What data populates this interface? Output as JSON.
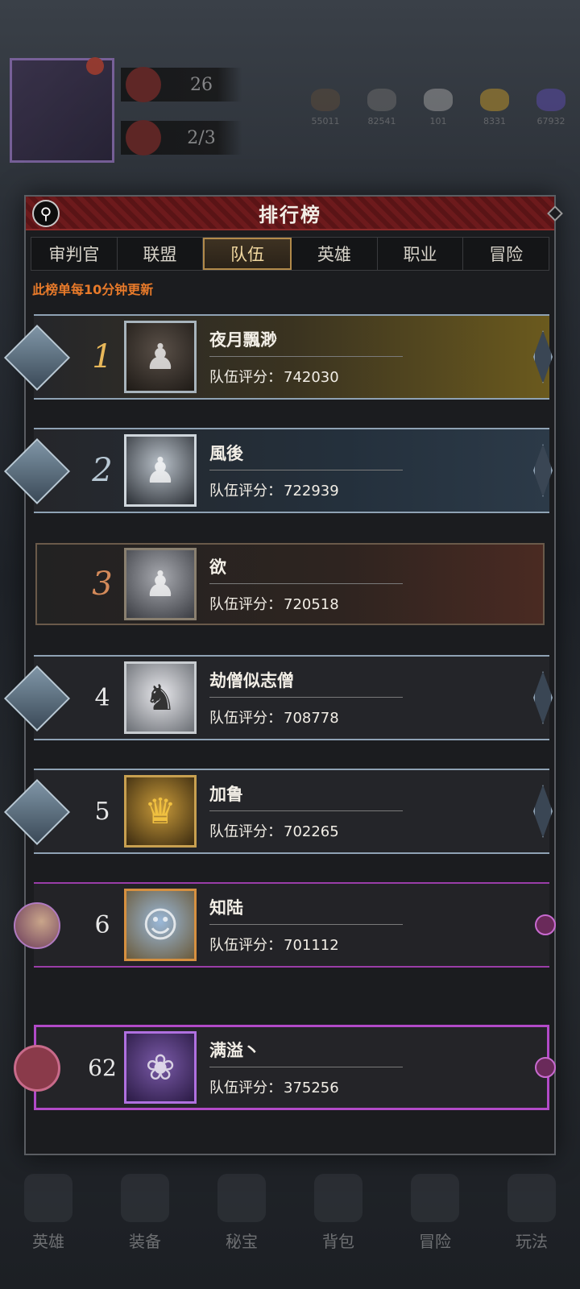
{
  "hud": {
    "stat1": "26",
    "stat2": "2/3",
    "resources": [
      "55011",
      "82541",
      "101",
      "8331",
      "67932"
    ]
  },
  "panel": {
    "title": "排行榜",
    "tabs": [
      "审判官",
      "联盟",
      "队伍",
      "英雄",
      "职业",
      "冒险"
    ],
    "active_tab": "队伍",
    "note": "此榜单每10分钟更新"
  },
  "score_label": "队伍评分：",
  "rows": [
    {
      "rank": "1",
      "name": "夜月飄渺",
      "score": "742030"
    },
    {
      "rank": "2",
      "name": "風後",
      "score": "722939"
    },
    {
      "rank": "3",
      "name": "欲",
      "score": "720518"
    },
    {
      "rank": "4",
      "name": "劫僧似志僧",
      "score": "708778"
    },
    {
      "rank": "5",
      "name": "加鲁",
      "score": "702265"
    },
    {
      "rank": "6",
      "name": "知陆",
      "score": "701112"
    }
  ],
  "my_row": {
    "rank": "62",
    "name": "满溢丶",
    "score": "375256"
  },
  "bottom_nav": [
    "英雄",
    "装备",
    "秘宝",
    "背包",
    "冒险",
    "玩法"
  ]
}
